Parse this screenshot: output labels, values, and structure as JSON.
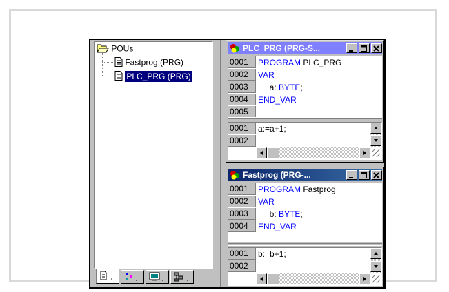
{
  "tree": {
    "root_label": "POUs",
    "items": [
      {
        "label": "Fastprog (PRG)",
        "selected": false
      },
      {
        "label": "PLC_PRG (PRG)",
        "selected": true
      }
    ]
  },
  "tabs": [
    {
      "icon": "pous-tab-icon",
      "active": true
    },
    {
      "icon": "datatypes-tab-icon",
      "active": false
    },
    {
      "icon": "visualizations-tab-icon",
      "active": false
    },
    {
      "icon": "resources-tab-icon",
      "active": false
    }
  ],
  "window_plc": {
    "title": "PLC_PRG (PRG-S...",
    "decl": [
      {
        "line": "0001",
        "parts": [
          {
            "t": "PROGRAM",
            "kw": true
          },
          {
            "t": " PLC_PRG",
            "kw": false
          }
        ]
      },
      {
        "line": "0002",
        "parts": [
          {
            "t": "VAR",
            "kw": true
          }
        ]
      },
      {
        "line": "0003",
        "parts": [
          {
            "t": "     a: ",
            "kw": false
          },
          {
            "t": "BYTE",
            "kw": true
          },
          {
            "t": ";",
            "kw": false
          }
        ]
      },
      {
        "line": "0004",
        "parts": [
          {
            "t": "END_VAR",
            "kw": true
          }
        ]
      },
      {
        "line": "0005",
        "parts": []
      }
    ],
    "body": [
      {
        "line": "0001",
        "text": "a:=a+1;"
      },
      {
        "line": "0002",
        "text": ""
      }
    ]
  },
  "window_fast": {
    "title": "Fastprog (PRG-...",
    "decl": [
      {
        "line": "0001",
        "parts": [
          {
            "t": "PROGRAM",
            "kw": true
          },
          {
            "t": " Fastprog",
            "kw": false
          }
        ]
      },
      {
        "line": "0002",
        "parts": [
          {
            "t": "VAR",
            "kw": true
          }
        ]
      },
      {
        "line": "0003",
        "parts": [
          {
            "t": "     b: ",
            "kw": false
          },
          {
            "t": "BYTE",
            "kw": true
          },
          {
            "t": ";",
            "kw": false
          }
        ]
      },
      {
        "line": "0004",
        "parts": [
          {
            "t": "END_VAR",
            "kw": true
          }
        ]
      }
    ],
    "body": [
      {
        "line": "0001",
        "text": "b:=b+1;"
      },
      {
        "line": "0002",
        "text": ""
      }
    ]
  },
  "colors": {
    "keyword": "#0000ff",
    "selection": "#00007f",
    "active_title": "#0a246a",
    "inactive_title": "#8080ff"
  }
}
